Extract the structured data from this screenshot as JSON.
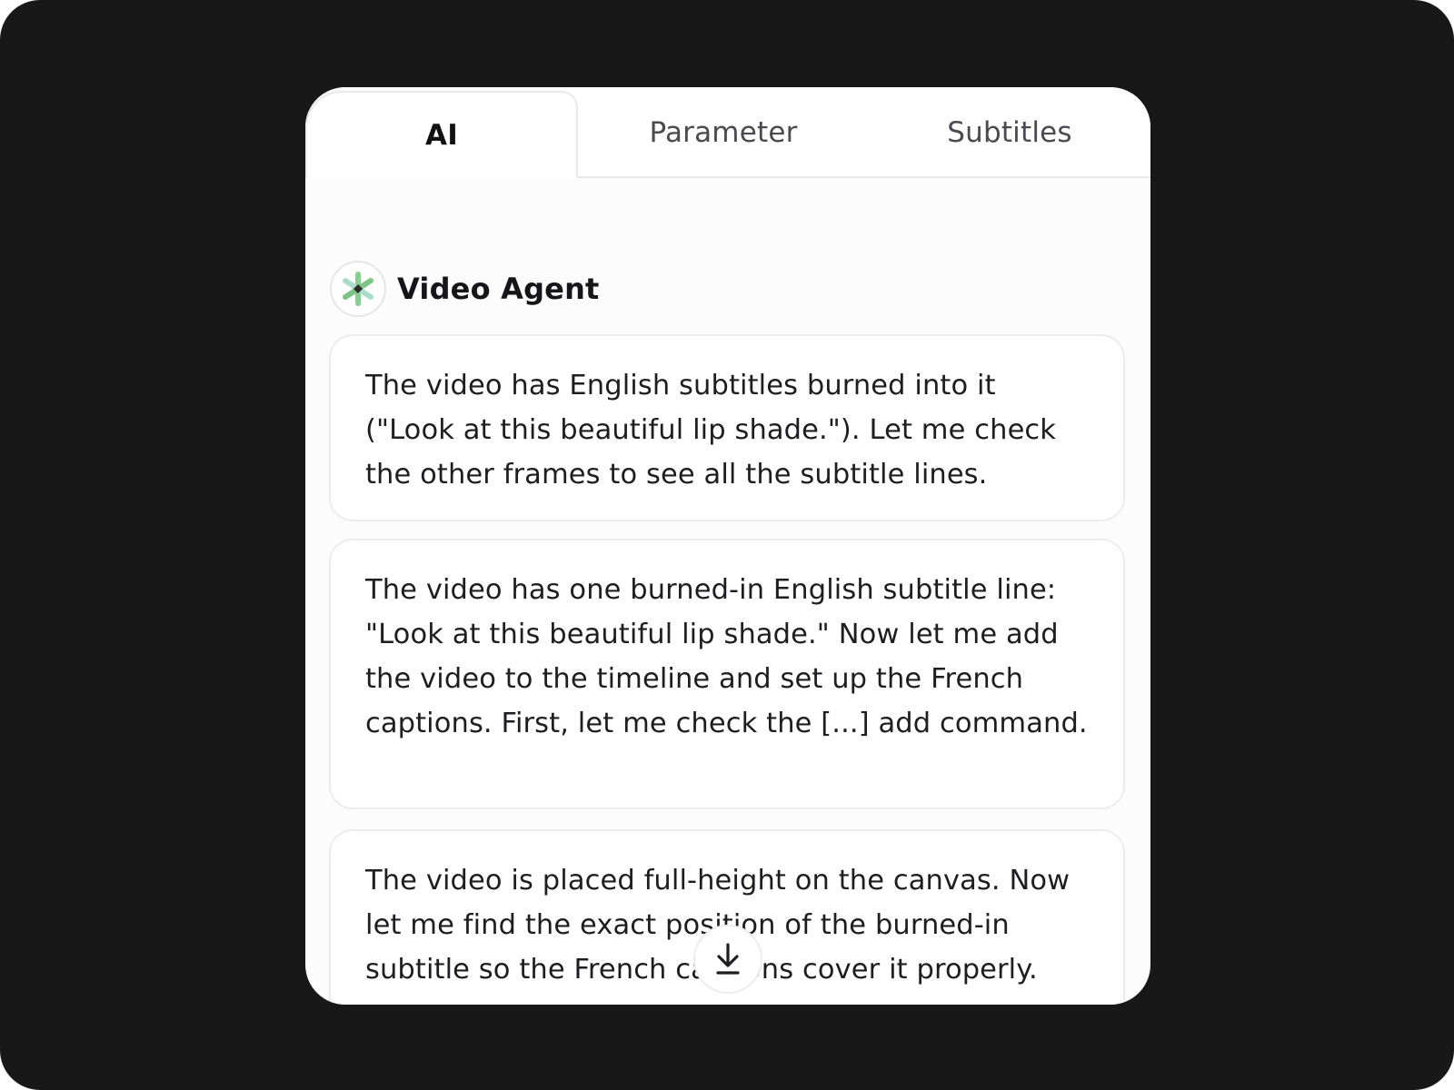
{
  "tabs": [
    {
      "label": "AI",
      "active": true
    },
    {
      "label": "Parameter",
      "active": false
    },
    {
      "label": "Subtitles",
      "active": false
    }
  ],
  "agent": {
    "name": "Video Agent",
    "avatar_icon": "sparkle-icon"
  },
  "messages": [
    {
      "text": "The video has English subtitles burned into it (\"Look at this beautiful lip shade.\"). Let me check the other frames to see all the subtitle lines."
    },
    {
      "text": "The video has one burned-in English subtitle line: \"Look at this beautiful lip shade.\" Now let me add the video to the timeline and set up the French captions. First, let me check the [...] add command."
    },
    {
      "text": "The video is placed full-height on the canvas. Now let me find the exact position of the burned-in subtitle so the French captions cover it properly."
    }
  ],
  "scroll_button": {
    "icon": "arrow-down-icon"
  },
  "colors": {
    "backdrop": "#181818",
    "panel": "#fcfcfc",
    "card_border": "#ececef",
    "text": "#1e1e22",
    "sparkle_green": "#7fc98a",
    "sparkle_teal": "#9fd4c8"
  }
}
